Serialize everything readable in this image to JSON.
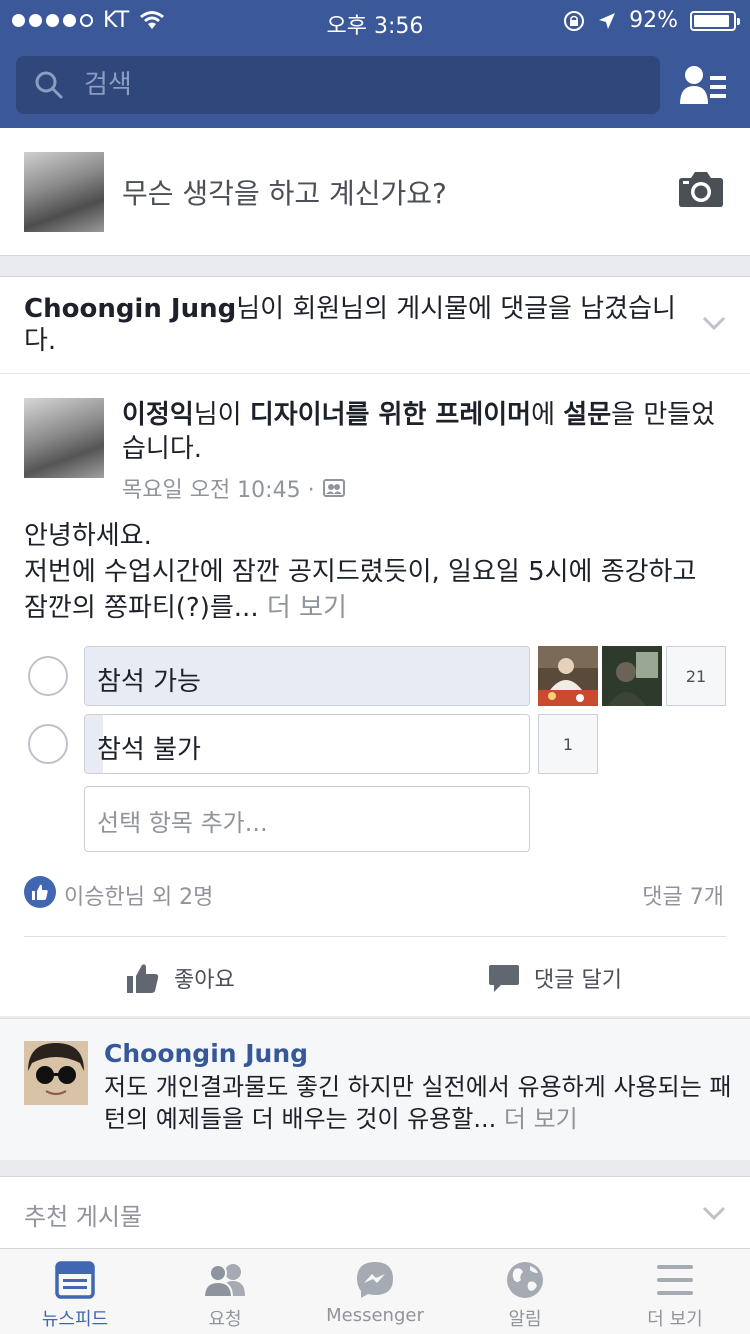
{
  "status_bar": {
    "carrier": "KT",
    "time": "오후 3:56",
    "battery": "92%",
    "battery_level": 0.92
  },
  "search": {
    "placeholder": "검색"
  },
  "composer": {
    "prompt": "무슨 생각을 하고 계신가요?"
  },
  "notification": {
    "actor": "Choongin Jung",
    "text": "님이 회원님의 게시물에 댓글을 남겼습니다."
  },
  "post": {
    "author": "이정익",
    "mid1": "님이 ",
    "group": "디자이너를 위한 프레이머",
    "mid2": "에 ",
    "object": "설문",
    "tail": "을 만들었습니다.",
    "timestamp": "목요일 오전 10:45 ·",
    "body_line1": "안녕하세요.",
    "body_line2": "저번에 수업시간에 잠깐 공지드렸듯이, 일요일 5시에 종강하고 잠깐의 쫑파티(?)를... ",
    "more": "더 보기",
    "poll": {
      "options": [
        {
          "label": "참석 가능",
          "votes": "21",
          "share": 1.0
        },
        {
          "label": "참석 불가",
          "votes": "1",
          "share": 0.04
        }
      ],
      "add_placeholder": "선택 항목 추가..."
    },
    "likes_text": "이승한님 외 2명",
    "comments_count": "댓글 7개",
    "like_label": "좋아요",
    "comment_label": "댓글 달기"
  },
  "comment_preview": {
    "author": "Choongin Jung",
    "text": "저도 개인결과물도 좋긴 하지만 실전에서 유용하게 사용되는 패턴의 예제들을 더 배우는 것이 유용할... ",
    "more": "더 보기"
  },
  "suggested": {
    "label": "추천 게시물"
  },
  "tabs": [
    {
      "label": "뉴스피드",
      "icon": "newsfeed-icon",
      "active": true
    },
    {
      "label": "요청",
      "icon": "friend-requests-icon",
      "active": false
    },
    {
      "label": "Messenger",
      "icon": "messenger-icon",
      "active": false
    },
    {
      "label": "알림",
      "icon": "globe-icon",
      "active": false
    },
    {
      "label": "더 보기",
      "icon": "menu-icon",
      "active": false
    }
  ],
  "colors": {
    "brand": "#3b5998",
    "accent": "#4267b2",
    "muted": "#90949c"
  }
}
